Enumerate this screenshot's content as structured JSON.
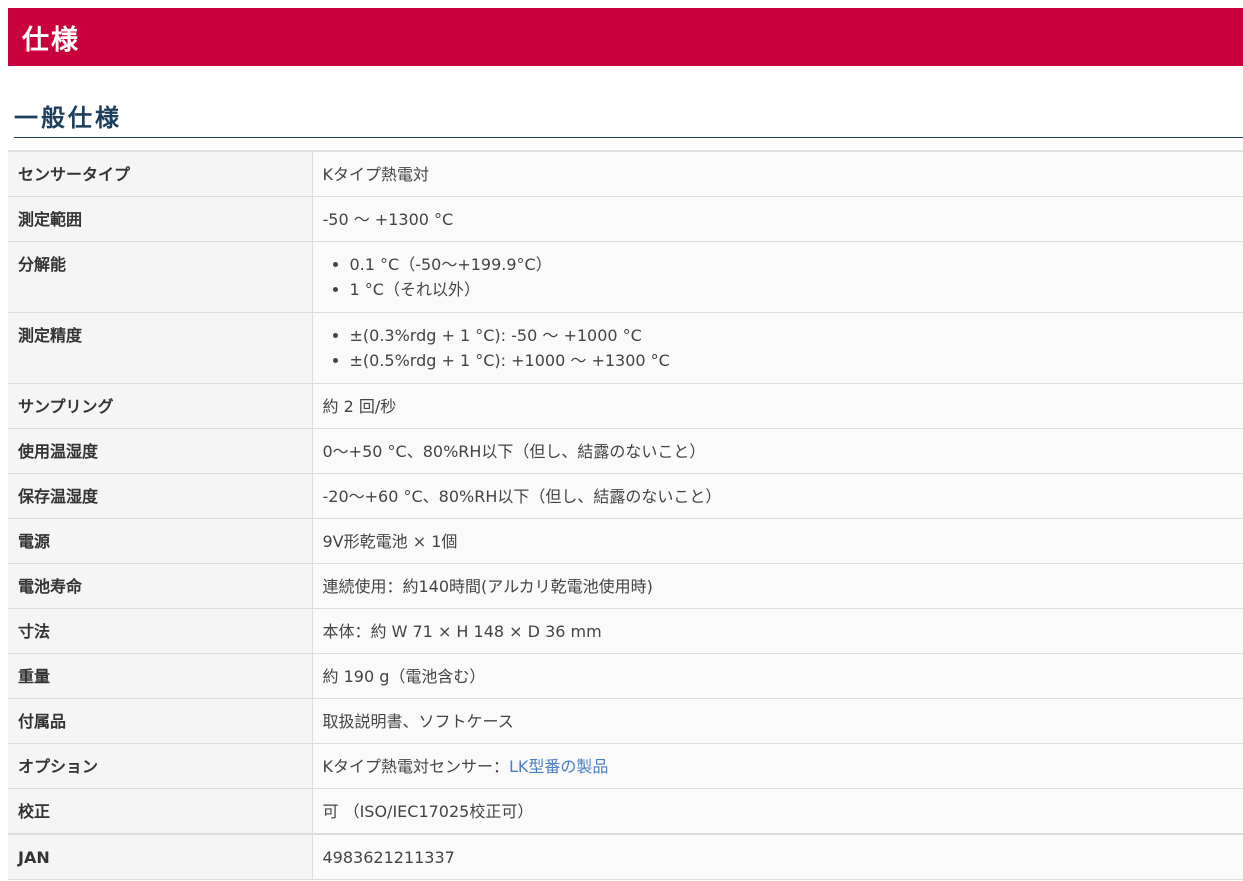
{
  "header": {
    "title": "仕様"
  },
  "section": {
    "title": "一般仕様"
  },
  "specs": {
    "sensor_type": {
      "label": "センサータイプ",
      "value": "Kタイプ熱電対"
    },
    "measurement_range": {
      "label": "測定範囲",
      "value": "-50 〜 +1300 °C"
    },
    "resolution": {
      "label": "分解能",
      "items": [
        "0.1 °C（-50〜+199.9°C）",
        "1 °C（それ以外）"
      ]
    },
    "accuracy": {
      "label": "測定精度",
      "items": [
        "±(0.3%rdg + 1 °C): -50 〜 +1000 °C",
        "±(0.5%rdg + 1 °C): +1000 〜 +1300 °C"
      ]
    },
    "sampling": {
      "label": "サンプリング",
      "value": "約 2 回/秒"
    },
    "operating_env": {
      "label": "使用温湿度",
      "value": "0〜+50 °C、80%RH以下（但し、結露のないこと）"
    },
    "storage_env": {
      "label": "保存温湿度",
      "value": "-20〜+60 °C、80%RH以下（但し、結露のないこと）"
    },
    "power": {
      "label": "電源",
      "value": "9V形乾電池 × 1個"
    },
    "battery_life": {
      "label": "電池寿命",
      "value": "連続使用：約140時間(アルカリ乾電池使用時)"
    },
    "dimensions": {
      "label": "寸法",
      "value": "本体：約 W 71 × H 148 × D 36 mm"
    },
    "weight": {
      "label": "重量",
      "value": "約 190 g（電池含む）"
    },
    "accessories": {
      "label": "付属品",
      "value": "取扱説明書、ソフトケース"
    },
    "options": {
      "label": "オプション",
      "value_prefix": "Kタイプ熱電対センサー：",
      "link_text": "LK型番の製品"
    },
    "calibration": {
      "label": "校正",
      "value": "可 （ISO/IEC17025校正可）"
    },
    "jan": {
      "label": "JAN",
      "value": "4983621211337"
    }
  },
  "colors": {
    "header_bg": "#c8003c",
    "heading_text": "#1c3f5e",
    "link": "#4a7fc1"
  }
}
